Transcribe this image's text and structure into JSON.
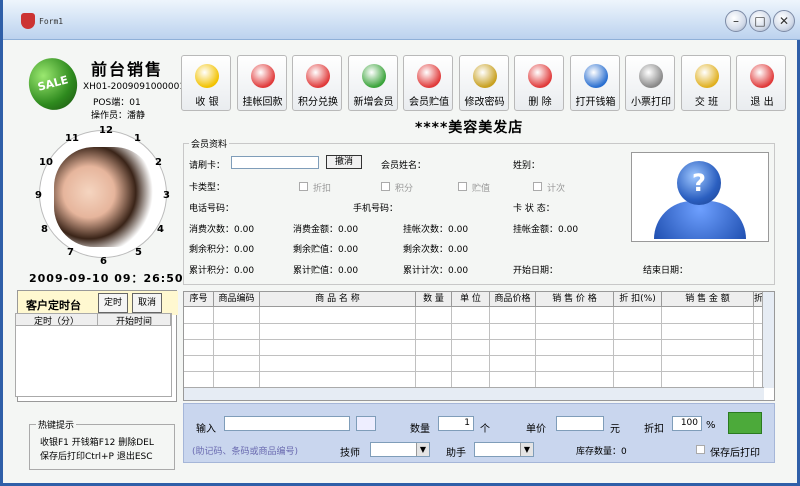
{
  "window": {
    "title": "Form1"
  },
  "left": {
    "store_title": "前台销售",
    "receipt_no": "XH01-2009091000001",
    "pos": "POS端：01",
    "operator": "操作员：潘静",
    "datetime": "2009-09-10   09：26:50",
    "clock_numbers": [
      "11",
      "12",
      "1",
      "2",
      "10",
      "3",
      "9",
      "4",
      "8",
      "7",
      "6",
      "5"
    ],
    "custom_title": "客户定时台",
    "custom_btn1": "定时",
    "custom_btn2": "取消",
    "custom_cols": [
      "定时（分）",
      "开始时间"
    ],
    "hotkeys_title": "热键提示",
    "hotkeys_line1": "收银F1  开钱箱F12 删除DEL",
    "hotkeys_line2": "保存后打印Ctrl+P 退出ESC"
  },
  "toolbar": [
    {
      "label": "收  银",
      "icon": "money-bag-icon",
      "color": "#f2c200"
    },
    {
      "label": "挂帐回款",
      "icon": "heart-plus-icon",
      "color": "#e03a3a"
    },
    {
      "label": "积分兑换",
      "icon": "heart-icon",
      "color": "#e03a3a"
    },
    {
      "label": "新增会员",
      "icon": "add-user-icon",
      "color": "#3aa33a"
    },
    {
      "label": "会员贮值",
      "icon": "heart-plus-icon",
      "color": "#e03a3a"
    },
    {
      "label": "修改密码",
      "icon": "key-icon",
      "color": "#c8a020"
    },
    {
      "label": "删  除",
      "icon": "heart-minus-icon",
      "color": "#e03a3a"
    },
    {
      "label": "打开钱箱",
      "icon": "power-icon",
      "color": "#2a6fd0"
    },
    {
      "label": "小票打印",
      "icon": "printer-icon",
      "color": "#888888"
    },
    {
      "label": "交  班",
      "icon": "key-icon",
      "color": "#e0b020"
    },
    {
      "label": "退  出",
      "icon": "exit-person-icon",
      "color": "#e03a3a"
    }
  ],
  "shop_name": "****美容美发店",
  "member": {
    "legend": "会员资料",
    "card_label": "请刷卡：",
    "cancel": "撤消",
    "name_label": "会员姓名：",
    "gender_label": "姓别：",
    "type_label": "卡类型：",
    "opt_discount": "折扣",
    "opt_points": "积分",
    "opt_store": "贮值",
    "opt_count": "计次",
    "phone_label": "电话号码：",
    "mobile_label": "手机号码：",
    "status_label": "卡  状  态：",
    "consume_count": "消费次数：0.00",
    "consume_amount": "消费金额：0.00",
    "credit_count": "挂帐次数：0.00",
    "credit_amount": "挂帐金额：0.00",
    "remain_points": "剩余积分：0.00",
    "remain_store": "剩余贮值：0.00",
    "remain_count": "剩余次数：0.00",
    "total_points": "累计积分：0.00",
    "total_store": "累计贮值：0.00",
    "total_count": "累计计次：0.00",
    "start_date": "开始日期：",
    "end_date": "结束日期："
  },
  "grid": {
    "columns": [
      "序号",
      "商品编码",
      "商    品    名    称",
      "数  量",
      "单  位",
      "商品价格",
      "销  售  价  格",
      "折 扣(%)",
      "销  售  金  额",
      "折"
    ]
  },
  "input": {
    "input_label": "输入",
    "hint": "(助记码、条码或商品编号)",
    "qty_label": "数量",
    "qty_value": "1",
    "qty_unit": "个",
    "price_label": "单价",
    "price_unit": "元",
    "discount_label": "折扣",
    "discount_value": "100",
    "discount_unit": "%",
    "tech_label": "技师",
    "assistant_label": "助手",
    "stock_label": "库存数量：0",
    "save_print_label": "保存后打印"
  }
}
